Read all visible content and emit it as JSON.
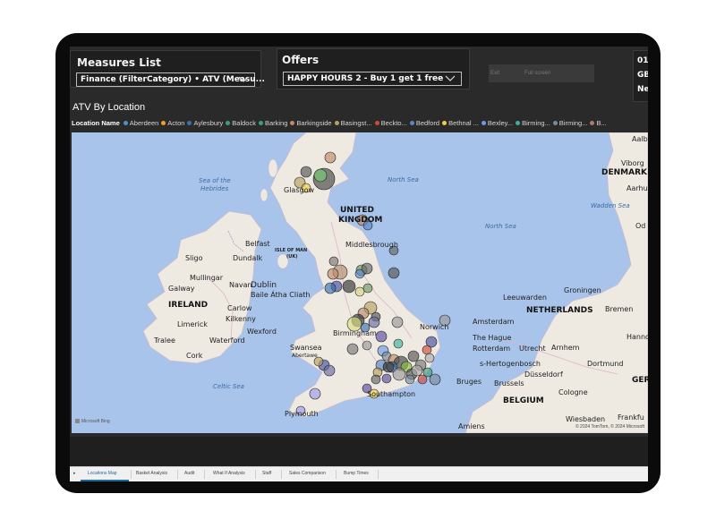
{
  "slicers": {
    "measures": {
      "title": "Measures List",
      "value": "Finance (FilterCategory) • ATV (Measu..."
    },
    "offers": {
      "title": "Offers",
      "value": "HAPPY HOURS 2 - Buy 1 get 1 free"
    }
  },
  "ghost_labels": [
    "Exit",
    "Full screen"
  ],
  "card": {
    "line1": "01",
    "line2": "GB",
    "line3": "Ne"
  },
  "map_visual": {
    "title": "ATV By Location",
    "legend_label": "Location Name",
    "legend_items": [
      {
        "name": "Aberdeen",
        "color": "#4e8ecf"
      },
      {
        "name": "Acton",
        "color": "#f0a030"
      },
      {
        "name": "Aylesbury",
        "color": "#3a6fb0"
      },
      {
        "name": "Baldock",
        "color": "#3aa07a"
      },
      {
        "name": "Barking",
        "color": "#3aa07a"
      },
      {
        "name": "Barkingside",
        "color": "#c08a6a"
      },
      {
        "name": "Basingst...",
        "color": "#b8a060"
      },
      {
        "name": "Beckto...",
        "color": "#d04a3a"
      },
      {
        "name": "Bedford",
        "color": "#5a86c8"
      },
      {
        "name": "Bethnal ...",
        "color": "#f0d040"
      },
      {
        "name": "Bexley...",
        "color": "#6a9ae8"
      },
      {
        "name": "Birming...",
        "color": "#3ab0a0"
      },
      {
        "name": "Birming...",
        "color": "#7a8aa0"
      },
      {
        "name": "B...",
        "color": "#b07a6a"
      }
    ],
    "labels": {
      "uk": "UNITED",
      "uk2": "KINGDOM",
      "ireland": "IRELAND",
      "netherlands": "NETHERLANDS",
      "denmark": "DENMARK",
      "belgium": "BELGIUM",
      "ger": "GER",
      "isle_of_man": "ISLE OF MAN",
      "isle_of_man2": "(UK)",
      "north_sea": "North Sea",
      "north_sea2": "North Sea",
      "sea_hebrides": "Sea of the",
      "sea_hebrides2": "Hebrides",
      "celtic_sea": "Celtic Sea",
      "wadden_sea": "Wadden Sea",
      "dublin": "Dublin",
      "dublin2": "Baile Átha Cliath",
      "belfast": "Belfast",
      "dundalk": "Dundalk",
      "sligo": "Sligo",
      "galway": "Galway",
      "mullingar": "Mullingar",
      "navan": "Navan",
      "kilkenny": "Kilkenny",
      "carlow": "Carlow",
      "limerick": "Limerick",
      "waterford": "Waterford",
      "wexford": "Wexford",
      "tralee": "Tralee",
      "cork": "Cork",
      "glasgow": "Glasgow",
      "middlesbrough": "Middlesbrough",
      "birmingham": "Birmingham",
      "norwich": "Norwich",
      "swansea": "Swansea",
      "swansea2": "Abertawe",
      "plymouth": "Plymouth",
      "southampton": "Southampton",
      "amsterdam": "Amsterdam",
      "the_hague": "The Hague",
      "rotterdam": "Rotterdam",
      "utrecht": "Utrecht",
      "leeuwarden": "Leeuwarden",
      "groningen": "Groningen",
      "bremen": "Bremen",
      "hanno": "Hanno",
      "arnhem": "Arnhem",
      "s_hertogenbosch": "s-Hertogenbosch",
      "dortmund": "Dortmund",
      "dusseldorf": "Düsseldorf",
      "bruges": "Bruges",
      "brussels": "Brussels",
      "cologne": "Cologne",
      "wiesbaden": "Wiesbaden",
      "frankfurt": "Frankfu",
      "amiens": "Amiens",
      "viborg": "Viborg",
      "aalb": "Aalb",
      "aarhus": "Aarhus",
      "odense": "Od"
    },
    "attribution": "Microsoft Bing",
    "copyright": "© 2024 TomTom, © 2024 Microsoft"
  },
  "tabs": [
    "Locations Map",
    "Basket Analysis",
    "Audit",
    "What If Analysis",
    "Staff",
    "Sales Comparison",
    "Bump Times"
  ],
  "active_tab": "Locations Map"
}
